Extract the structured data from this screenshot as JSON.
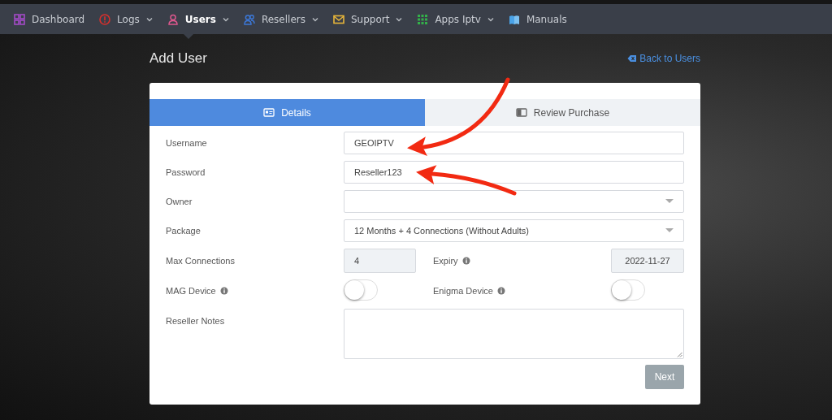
{
  "nav": [
    {
      "label": "Dashboard",
      "dropdown": false,
      "selected": false
    },
    {
      "label": "Logs",
      "dropdown": true,
      "selected": false
    },
    {
      "label": "Users",
      "dropdown": true,
      "selected": true
    },
    {
      "label": "Resellers",
      "dropdown": true,
      "selected": false
    },
    {
      "label": "Support",
      "dropdown": true,
      "selected": false
    },
    {
      "label": "Apps Iptv",
      "dropdown": true,
      "selected": false
    },
    {
      "label": "Manuals",
      "dropdown": false,
      "selected": false
    }
  ],
  "page": {
    "title": "Add User",
    "back_link": "Back to Users"
  },
  "tabs": [
    {
      "label": "Details",
      "selected": true
    },
    {
      "label": "Review Purchase",
      "selected": false
    }
  ],
  "fields": [
    {
      "kind": "text",
      "label": "Username",
      "value": "GEOIPTV"
    },
    {
      "kind": "text",
      "label": "Password",
      "value": "Reseller123"
    },
    {
      "kind": "select",
      "label": "Owner"
    },
    {
      "kind": "select",
      "label": "Package",
      "value": "12 Months + 4 Connections (Without Adults)"
    },
    {
      "kind": "pair",
      "label": "Max Connections",
      "value": "4",
      "label2": "Expiry",
      "info2": true,
      "value2": "2022-11-27"
    },
    {
      "kind": "toggles",
      "label": "MAG Device",
      "info": true,
      "on": false,
      "label2": "Enigma Device",
      "info2": true,
      "on2": false
    },
    {
      "kind": "textarea",
      "label": "Reseller Notes"
    }
  ],
  "buttons": [
    {
      "label": "Next",
      "disabled": true
    }
  ],
  "annotations": [
    {
      "kind": "arrow"
    },
    {
      "kind": "arrow"
    }
  ]
}
